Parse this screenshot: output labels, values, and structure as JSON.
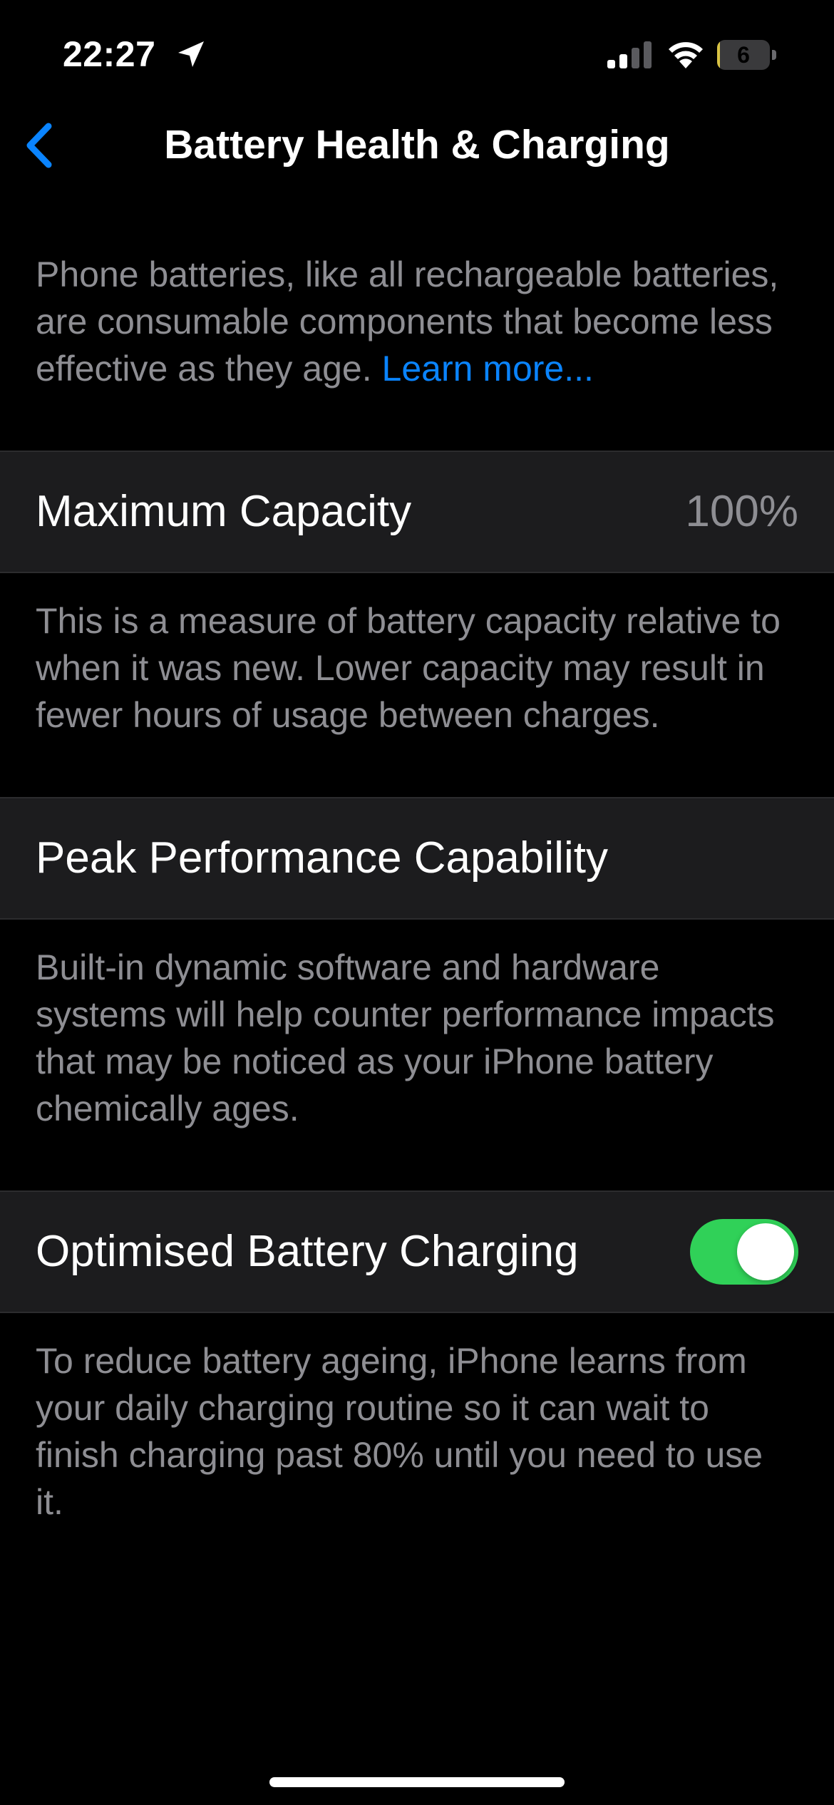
{
  "status_bar": {
    "time": "22:27",
    "battery_level": "6",
    "battery_fraction": 0.06,
    "battery_color": "#d9c343",
    "icons": [
      "location-arrow-icon",
      "cellular-signal-icon",
      "wifi-icon",
      "battery-icon"
    ]
  },
  "nav": {
    "back_icon": "chevron-left-icon",
    "title": "Battery Health & Charging"
  },
  "intro": {
    "text": "Phone batteries, like all rechargeable batteries, are consumable components that become less effective as they age.",
    "link": "Learn more..."
  },
  "maximum_capacity": {
    "label": "Maximum Capacity",
    "value": "100%",
    "description": "This is a measure of battery capacity relative to when it was new. Lower capacity may result in fewer hours of usage between charges."
  },
  "peak_performance": {
    "label": "Peak Performance Capability",
    "description": "Built-in dynamic software and hardware systems will help counter performance impacts that may be noticed as your iPhone battery chemically ages."
  },
  "optimised_charging": {
    "label": "Optimised Battery Charging",
    "enabled": true,
    "toggle_color": "#30d158",
    "description": "To reduce battery ageing, iPhone learns from your daily charging routine so it can wait to finish charging past 80% until you need to use it."
  },
  "colors": {
    "accent": "#0a84ff",
    "background": "#000000",
    "cell_background": "#1c1c1e",
    "secondary_text": "#8e8e93"
  }
}
